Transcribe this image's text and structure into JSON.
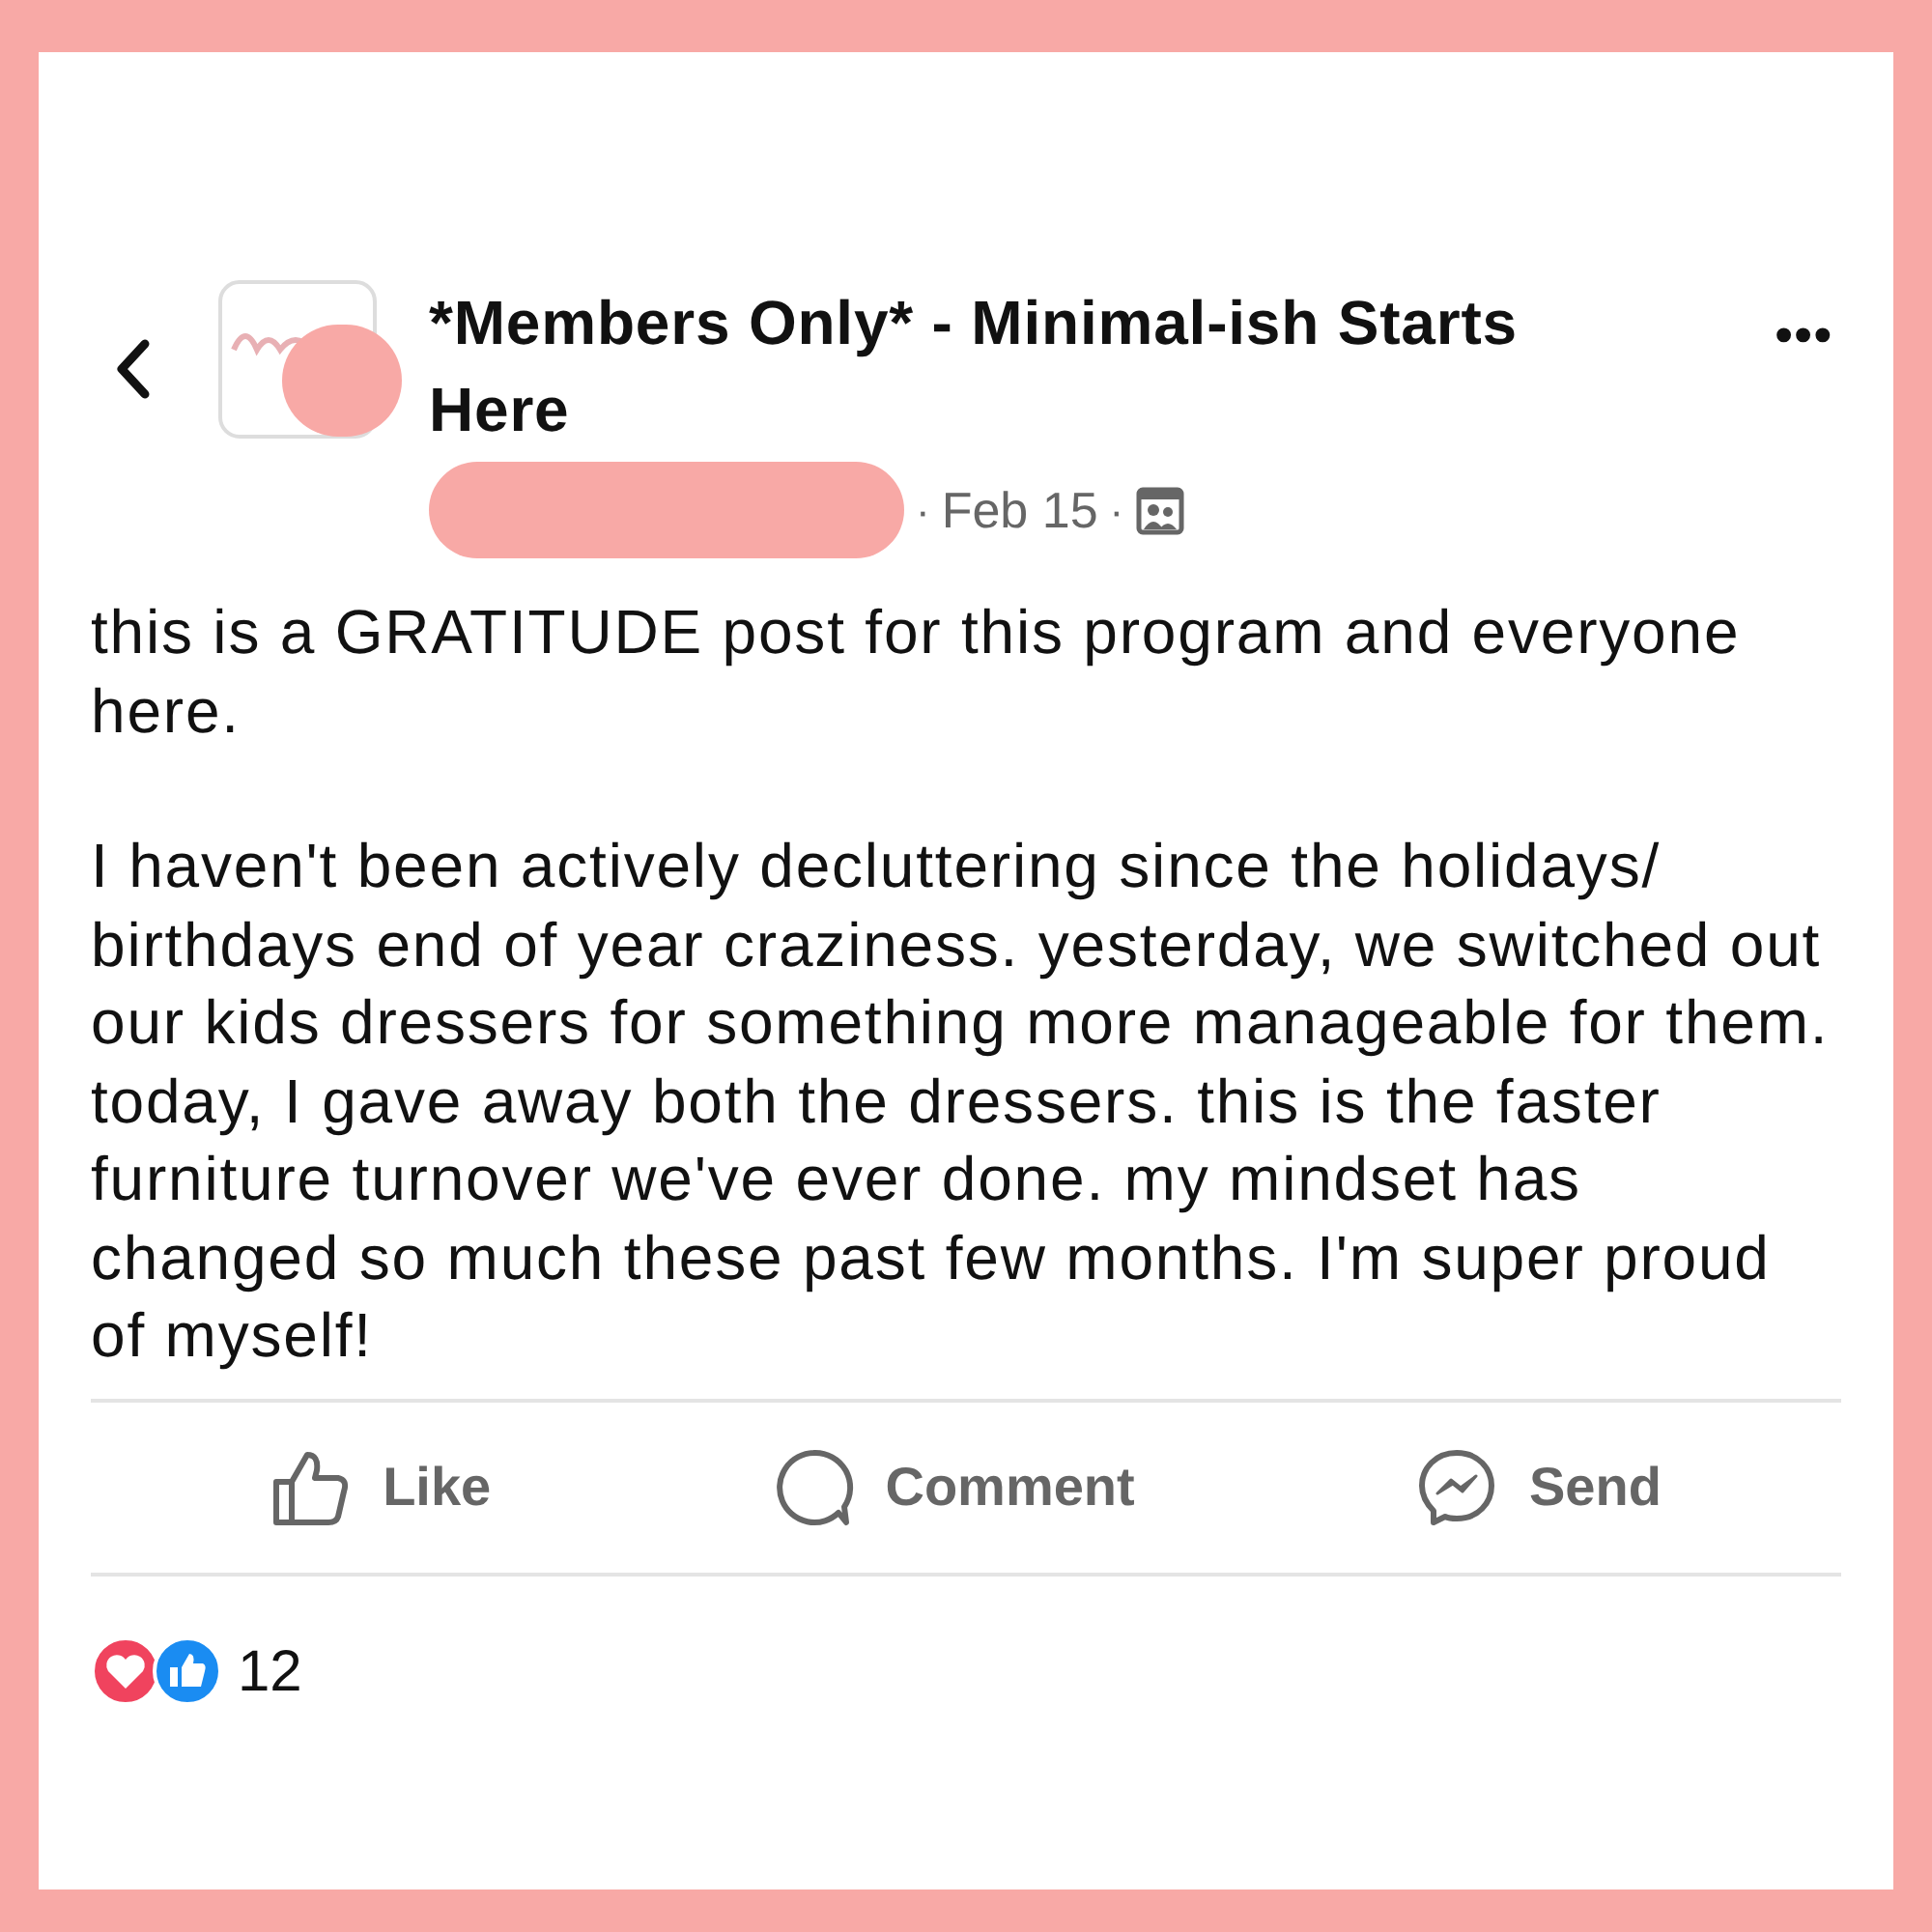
{
  "header": {
    "group_name": "*Members Only* - Minimal-ish Starts Here",
    "date": "Feb 15",
    "separator": "·",
    "more": "•••"
  },
  "post": {
    "paragraphs": [
      "this is a GRATITUDE post for this program and everyone here.",
      "I haven't been actively decluttering since the holidays/ birthdays end of year craziness. yesterday, we switched out our kids dressers for something more manageable for them. today, I gave away both the dressers. this is the faster furniture turnover we've ever done. my mindset has changed so much these past few months. I'm super proud of myself!"
    ]
  },
  "actions": [
    {
      "kind": "like",
      "label": "Like"
    },
    {
      "kind": "comment",
      "label": "Comment"
    },
    {
      "kind": "send",
      "label": "Send"
    }
  ],
  "reactions": {
    "count": "12"
  }
}
